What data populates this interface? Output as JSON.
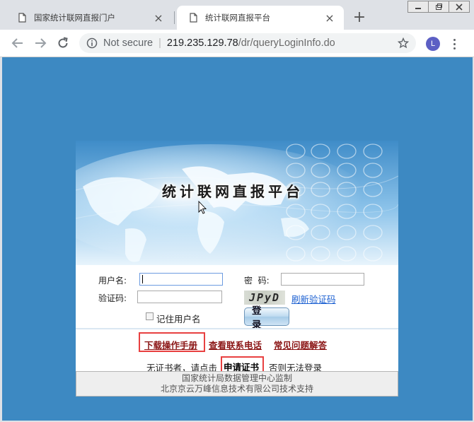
{
  "window": {
    "controls": [
      "minimize",
      "restore",
      "close"
    ]
  },
  "tabs": [
    {
      "title": "国家统计联网直报门户",
      "active": false
    },
    {
      "title": "统计联网直报平台",
      "active": true
    }
  ],
  "toolbar": {
    "security_label": "Not secure",
    "url_host": "219.235.129.78",
    "url_path": "/dr/queryLoginInfo.do",
    "profile_initial": "L"
  },
  "login": {
    "banner_title": "统计联网直报平台",
    "username_label": "用户名:",
    "password_label": "密  码:",
    "captcha_label": "验证码:",
    "captcha_text": "JPyD",
    "refresh_captcha": "刷新验证码",
    "remember_label": "记住用户名",
    "login_button": "登 录"
  },
  "links": {
    "download_manual": "下载操作手册",
    "contact_phone": "查看联系电话",
    "faq": "常见问题解答"
  },
  "certificate": {
    "notice_prefix": "无证书者，请点击",
    "apply_label": "申请证书",
    "notice_suffix": "否则无法登录"
  },
  "footer": {
    "line1": "国家统计局数据管理中心监制",
    "line2": "北京京云万峰信息技术有限公司技术支持"
  },
  "colors": {
    "page_background": "#3d89c2",
    "link_red": "#8b1515",
    "highlight": "#e84040",
    "refresh_link": "#1a5fd1"
  }
}
